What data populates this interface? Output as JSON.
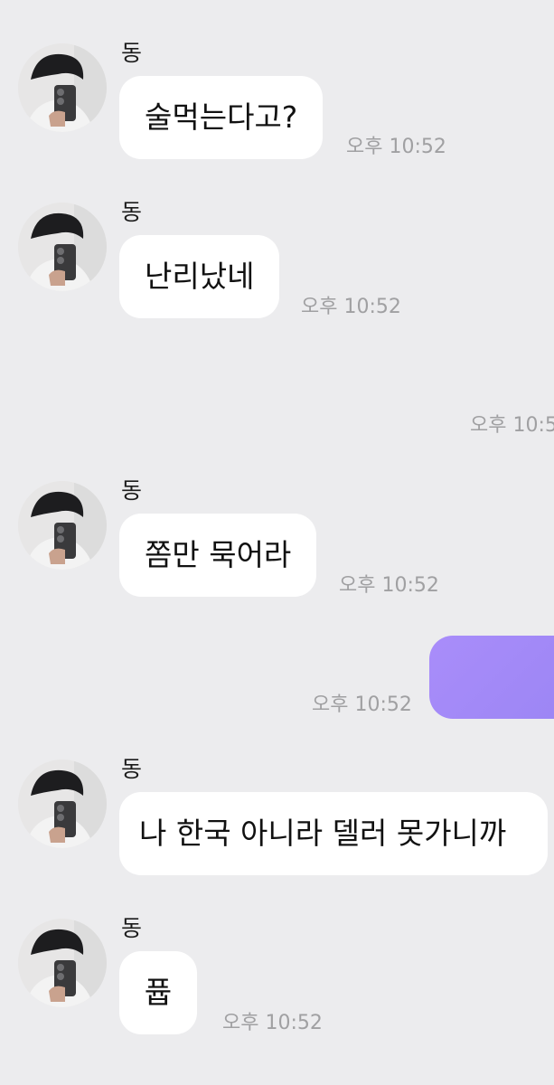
{
  "chat": {
    "messages": [
      {
        "sender": "동",
        "text": "술먹는다고?",
        "time": "오후 10:52"
      },
      {
        "sender": "동",
        "text": "난리났네",
        "time": "오후 10:52"
      },
      {
        "time_partial": "오후 10:5"
      },
      {
        "sender": "동",
        "text": "쫌만 묵어라",
        "time": "오후 10:52"
      },
      {
        "from_me": true,
        "time": "오후 10:52"
      },
      {
        "sender": "동",
        "text": "나 한국 아니라 델러 못가니까",
        "time": ""
      },
      {
        "sender": "동",
        "text": "퓹",
        "time": "오후 10:52"
      }
    ]
  },
  "colors": {
    "background": "#ececee",
    "incoming_bubble": "#ffffff",
    "outgoing_bubble": "#a08cf8",
    "timestamp": "#a0a0a2"
  }
}
